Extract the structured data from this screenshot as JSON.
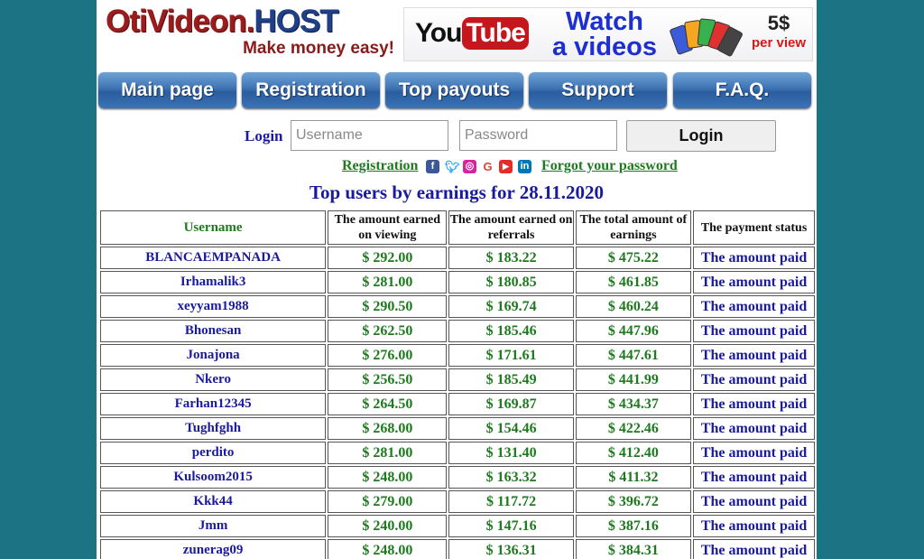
{
  "header": {
    "logo_title_main": "OtiVideon.",
    "logo_title_host": "HOST",
    "logo_tagline": "Make money easy!",
    "banner": {
      "you": "You",
      "tube": "Tube",
      "watch_line1": "Watch",
      "watch_line2": "a videos",
      "price_amount": "5$",
      "price_unit": "per view"
    }
  },
  "nav": {
    "items": [
      {
        "label": "Main page"
      },
      {
        "label": "Registration"
      },
      {
        "label": "Top payouts"
      },
      {
        "label": "Support"
      },
      {
        "label": "F.A.Q."
      }
    ]
  },
  "login": {
    "label": "Login",
    "username_placeholder": "Username",
    "password_placeholder": "Password",
    "button_label": "Login",
    "registration_link": "Registration",
    "forgot_link": "Forgot your password",
    "social_icons": [
      "facebook-icon",
      "twitter-icon",
      "instagram-icon",
      "google-icon",
      "youtube-icon",
      "linkedin-icon"
    ]
  },
  "top_users": {
    "title": "Top users by earnings for 28.11.2020",
    "columns": [
      "Username",
      "The amount earned on viewing",
      "The amount earned on referrals",
      "The total amount of earnings",
      "The payment status"
    ],
    "rows": [
      {
        "user": "BLANCAEMPANADA",
        "viewing": "$ 292.00",
        "referrals": "$ 183.22",
        "total": "$ 475.22",
        "status": "The amount paid"
      },
      {
        "user": "Irhamalik3",
        "viewing": "$ 281.00",
        "referrals": "$ 180.85",
        "total": "$ 461.85",
        "status": "The amount paid"
      },
      {
        "user": "xeyyam1988",
        "viewing": "$ 290.50",
        "referrals": "$ 169.74",
        "total": "$ 460.24",
        "status": "The amount paid"
      },
      {
        "user": "Bhonesan",
        "viewing": "$ 262.50",
        "referrals": "$ 185.46",
        "total": "$ 447.96",
        "status": "The amount paid"
      },
      {
        "user": "Jonajona",
        "viewing": "$ 276.00",
        "referrals": "$ 171.61",
        "total": "$ 447.61",
        "status": "The amount paid"
      },
      {
        "user": "Nkero",
        "viewing": "$ 256.50",
        "referrals": "$ 185.49",
        "total": "$ 441.99",
        "status": "The amount paid"
      },
      {
        "user": "Farhan12345",
        "viewing": "$ 264.50",
        "referrals": "$ 169.87",
        "total": "$ 434.37",
        "status": "The amount paid"
      },
      {
        "user": "Tughfghh",
        "viewing": "$ 268.00",
        "referrals": "$ 154.46",
        "total": "$ 422.46",
        "status": "The amount paid"
      },
      {
        "user": "perdito",
        "viewing": "$ 281.00",
        "referrals": "$ 131.40",
        "total": "$ 412.40",
        "status": "The amount paid"
      },
      {
        "user": "Kulsoom2015",
        "viewing": "$ 248.00",
        "referrals": "$ 163.32",
        "total": "$ 411.32",
        "status": "The amount paid"
      },
      {
        "user": "Kkk44",
        "viewing": "$ 279.00",
        "referrals": "$ 117.72",
        "total": "$ 396.72",
        "status": "The amount paid"
      },
      {
        "user": "Jmm",
        "viewing": "$ 240.00",
        "referrals": "$ 147.16",
        "total": "$ 387.16",
        "status": "The amount paid"
      },
      {
        "user": "zunerag09",
        "viewing": "$ 248.00",
        "referrals": "$ 136.31",
        "total": "$ 384.31",
        "status": "The amount paid"
      }
    ]
  },
  "colors": {
    "outer_background": "#1c7384",
    "link_green": "#1f7a1f",
    "heading_blue": "#1a1a9e",
    "nav_blue": "#3d73b3"
  }
}
